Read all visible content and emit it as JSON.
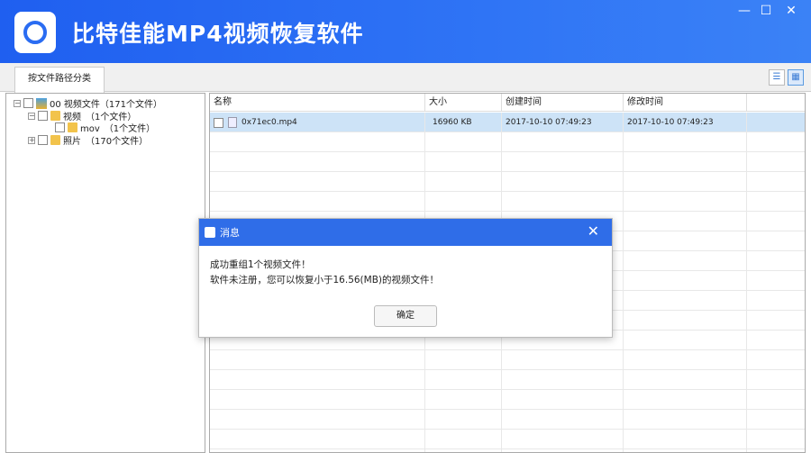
{
  "app": {
    "title": "比特佳能MP4视频恢复软件",
    "minimize": "—",
    "maximize": "☐",
    "close": "✕"
  },
  "tabs": [
    {
      "label": "按文件路径分类"
    }
  ],
  "view": {
    "list_icon": "☰",
    "grid_icon": "▦"
  },
  "tree": [
    {
      "label": "00 视频文件（171个文件）",
      "toggle": "−"
    },
    {
      "label": "视频　（1个文件）",
      "toggle": "−"
    },
    {
      "label": "mov　（1个文件）"
    },
    {
      "label": "照片　（170个文件）",
      "toggle": "+"
    }
  ],
  "table": {
    "columns": [
      "名称",
      "大小",
      "创建时间",
      "修改时间"
    ],
    "rows": [
      {
        "name": "0x71ec0.mp4",
        "size": "16960 KB",
        "created": "2017-10-10  07:49:23",
        "modified": "2017-10-10  07:49:23"
      }
    ]
  },
  "dialog": {
    "title": "消息",
    "line1": "成功重组1个视频文件！",
    "line2": "软件未注册，您可以恢复小于16.56(MB)的视频文件！",
    "ok": "确定",
    "close": "✕"
  }
}
